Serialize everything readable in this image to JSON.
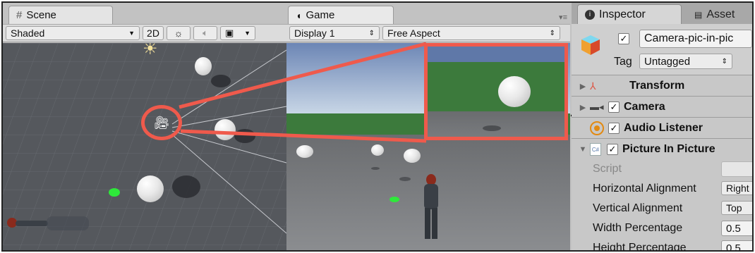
{
  "scene": {
    "tab_label": "Scene",
    "shading_mode": "Shaded",
    "toggle_2d": "2D"
  },
  "game": {
    "tab_label": "Game",
    "display": "Display 1",
    "aspect": "Free Aspect"
  },
  "inspector": {
    "tab_label": "Inspector",
    "asset_tab_label": "Asset",
    "object_name": "Camera-pic-in-pic",
    "tag_label": "Tag",
    "tag_value": "Untagged",
    "components": {
      "transform": "Transform",
      "camera": "Camera",
      "audio_listener": "Audio Listener",
      "picture_in_picture": "Picture In Picture"
    },
    "fields": {
      "script_label": "Script",
      "h_align_label": "Horizontal Alignment",
      "h_align_value": "Right",
      "v_align_label": "Vertical Alignment",
      "v_align_value": "Top",
      "width_label": "Width Percentage",
      "width_value": "0.5",
      "height_label": "Height Percentage",
      "height_value": "0.5"
    }
  },
  "colors": {
    "highlight": "#ef5a4c",
    "grass": "#3c7a3c"
  }
}
